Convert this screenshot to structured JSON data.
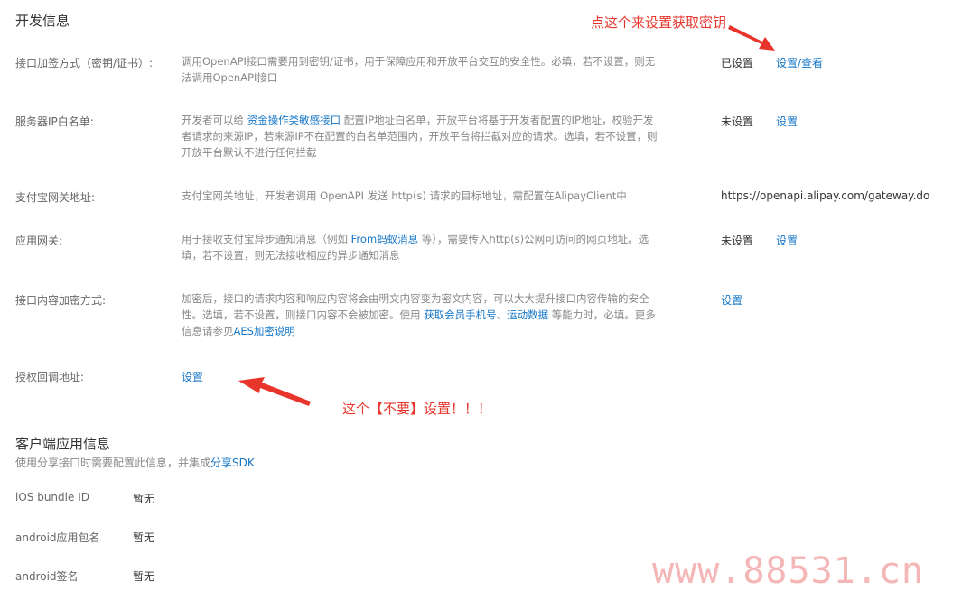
{
  "dev_info": {
    "title": "开发信息",
    "rows": [
      {
        "label": "接口加签方式（密钥/证书）:",
        "desc_1": "调用OpenAPI接口需要用到密钥/证书，用于保障应用和开放平台交互的安全性。必填，若不设置，则无",
        "desc_2": "法调用OpenAPI接口",
        "status": "已设置",
        "action": "设置/查看"
      },
      {
        "label": "服务器IP白名单:",
        "desc_1a": "开发者可以给 ",
        "desc_1link": "资金操作类敏感接口",
        "desc_1b": " 配置IP地址白名单，开放平台将基于开发者配置的IP地址，校验开发",
        "desc_2": "者请求的来源IP，若来源IP不在配置的白名单范围内，开放平台将拦截对应的请求。选填，若不设置，则",
        "desc_3": "开放平台默认不进行任何拦截",
        "status": "未设置",
        "action": "设置"
      },
      {
        "label": "支付宝网关地址:",
        "desc_1": "支付宝网关地址，开发者调用 OpenAPI 发送 http(s) 请求的目标地址，需配置在AlipayClient中",
        "value": "https://openapi.alipay.com/gateway.do"
      },
      {
        "label": "应用网关:",
        "desc_1a": "用于接收支付宝异步通知消息（例如 ",
        "desc_1link": "From蚂蚁消息",
        "desc_1b": " 等），需要传入http(s)公网可访问的网页地址。选",
        "desc_2": "填，若不设置，则无法接收相应的异步通知消息",
        "status": "未设置",
        "action": "设置"
      },
      {
        "label": "接口内容加密方式:",
        "desc_1": "加密后，接口的请求内容和响应内容将会由明文内容变为密文内容，可以大大提升接口内容传输的安全",
        "desc_2a": "性。选填，若不设置，则接口内容不会被加密。使用 ",
        "desc_2link1": "获取会员手机号",
        "desc_2sep": "、",
        "desc_2link2": "运动数据",
        "desc_2b": " 等能力时，必填。更多",
        "desc_3a": "信息请参见",
        "desc_3link": "AES加密说明",
        "action": "设置"
      },
      {
        "label": "授权回调地址:",
        "action": "设置"
      }
    ]
  },
  "client_info": {
    "title": "客户端应用信息",
    "subtitle_a": "使用分享接口时需要配置此信息，并集成",
    "subtitle_link": "分享SDK",
    "rows": [
      {
        "label": "iOS bundle ID",
        "value": "暂无"
      },
      {
        "label": "android应用包名",
        "value": "暂无"
      },
      {
        "label": "android签名",
        "value": "暂无"
      }
    ]
  },
  "annotations": {
    "top": "点这个来设置获取密钥",
    "bottom": "这个【不要】设置！！！",
    "color": "#e8352b"
  },
  "watermark": "www.88531.cn",
  "colors": {
    "link": "#1677c8",
    "label": "#666666",
    "desc": "#888888"
  }
}
